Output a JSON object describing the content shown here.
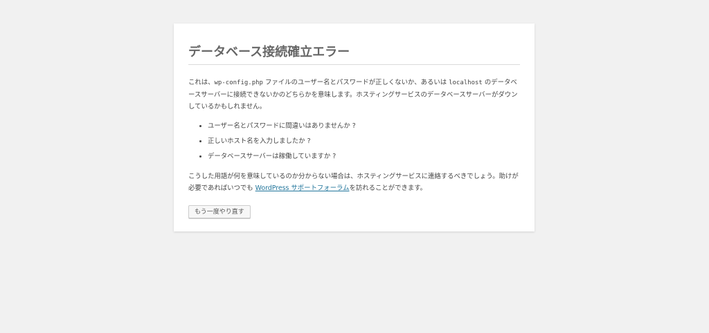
{
  "error_page": {
    "title": "データベース接続確立エラー",
    "intro": {
      "part1": "これは、",
      "config_file": "wp-config.php",
      "part2": " ファイルのユーザー名とパスワードが正しくないか、あるいは ",
      "host": "localhost",
      "part3": " のデータベースサーバーに接続できないかのどちらかを意味します。ホスティングサービスのデータベースサーバーがダウンしているかもしれません。"
    },
    "checks": [
      "ユーザー名とパスワードに間違いはありませんか ?",
      "正しいホスト名を入力しましたか ?",
      "データベースサーバーは稼働していますか ?"
    ],
    "help": {
      "part1": "こうした用語が何を意味しているのか分からない場合は、ホスティングサービスに連絡するべきでしょう。助けが必要であればいつでも ",
      "link_text": "WordPress サポートフォーラム",
      "part2": "を訪れることができます。"
    },
    "retry_button": "もう一度やり直す"
  },
  "colors": {
    "background": "#f1f1f1",
    "card": "#ffffff",
    "link": "#21759b",
    "title": "#666666"
  }
}
